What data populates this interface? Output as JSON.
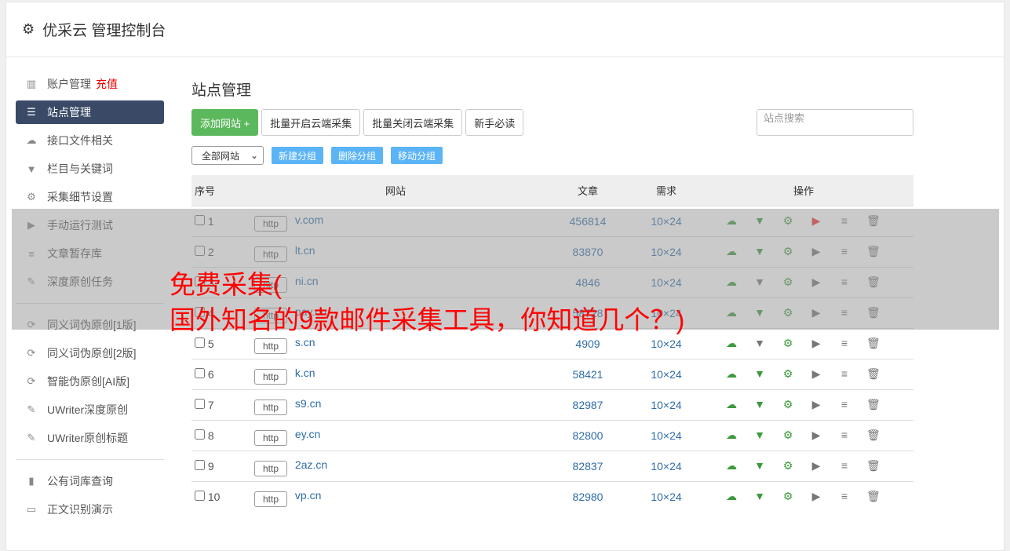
{
  "header": {
    "title": "优采云 管理控制台"
  },
  "sidebar": {
    "items": [
      {
        "label": "账户管理",
        "badge": "充值",
        "icon": "bar-chart-icon"
      },
      {
        "label": "站点管理",
        "icon": "server-icon",
        "active": true
      },
      {
        "label": "接口文件相关",
        "icon": "cloud-upload-icon"
      },
      {
        "label": "栏目与关键词",
        "icon": "filter-icon"
      },
      {
        "label": "采集细节设置",
        "icon": "gears-icon"
      },
      {
        "label": "手动运行测试",
        "icon": "play-icon"
      },
      {
        "label": "文章暂存库",
        "icon": "database-icon"
      },
      {
        "label": "深度原创任务",
        "icon": "edit-icon"
      },
      {
        "label": "同义词伪原创[1版]",
        "icon": "refresh-icon"
      },
      {
        "label": "同义词伪原创[2版]",
        "icon": "refresh-icon"
      },
      {
        "label": "智能伪原创[AI版]",
        "icon": "refresh-icon"
      },
      {
        "label": "UWriter深度原创",
        "icon": "edit-icon"
      },
      {
        "label": "UWriter原创标题",
        "icon": "edit-icon"
      },
      {
        "label": "公有词库查询",
        "icon": "book-icon"
      },
      {
        "label": "正文识别演示",
        "icon": "monitor-icon"
      }
    ]
  },
  "main": {
    "title": "站点管理",
    "add": "添加网站 +",
    "batch_open": "批量开启云端采集",
    "batch_close": "批量关闭云端采集",
    "guide": "新手必读",
    "search_placeholder": "站点搜索",
    "group_select": "全部网站",
    "new_group": "新建分组",
    "delete_group": "删除分组",
    "move_group": "移动分组",
    "columns": [
      "序号",
      "网站",
      "文章",
      "需求",
      "操作"
    ],
    "rows": [
      {
        "no": "1",
        "proto": "http",
        "site": "v.com",
        "articles": "456814",
        "demand": "10×24"
      },
      {
        "no": "2",
        "proto": "http",
        "site": "lt.cn",
        "articles": "83870",
        "demand": "10×24"
      },
      {
        "no": "3",
        "proto": "http",
        "site": "ni.cn",
        "articles": "4846",
        "demand": "10×24"
      },
      {
        "no": "4",
        "proto": "http",
        "site": "pay.cn",
        "articles": "58728",
        "demand": "10×24"
      },
      {
        "no": "5",
        "proto": "http",
        "site": "s.cn",
        "articles": "4909",
        "demand": "10×24"
      },
      {
        "no": "6",
        "proto": "http",
        "site": "k.cn",
        "articles": "58421",
        "demand": "10×24"
      },
      {
        "no": "7",
        "proto": "http",
        "site": "s9.cn",
        "articles": "82987",
        "demand": "10×24"
      },
      {
        "no": "8",
        "proto": "http",
        "site": "ey.cn",
        "articles": "82800",
        "demand": "10×24"
      },
      {
        "no": "9",
        "proto": "http",
        "site": "2az.cn",
        "articles": "82837",
        "demand": "10×24"
      },
      {
        "no": "10",
        "proto": "http",
        "site": "vp.cn",
        "articles": "82980",
        "demand": "10×24"
      }
    ]
  },
  "watermark": {
    "line1": "免费采集(",
    "line2": "国外知名的9款邮件采集工具，你知道几个？)"
  }
}
